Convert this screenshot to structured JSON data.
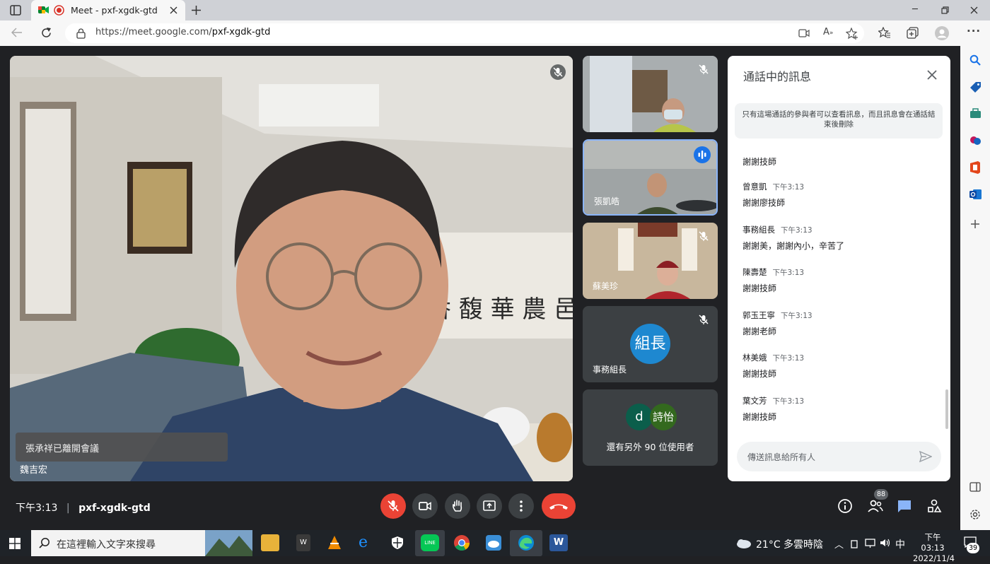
{
  "browser": {
    "tab_title": "Meet - pxf-xgdk-gtd",
    "url_host": "https://meet.google.com/",
    "url_path": "pxf-xgdk-gtd"
  },
  "main_video": {
    "speaker_name": "魏吉宏",
    "toast": "張承祥已離開會議"
  },
  "tiles": [
    {
      "name": ""
    },
    {
      "name": "張凱皓"
    },
    {
      "name": "蘇美珍"
    },
    {
      "name": "事務組長",
      "avatar_text": "組長"
    },
    {
      "avatars": [
        "d",
        "詩怡"
      ],
      "more_label": "還有另外 90 位使用者"
    }
  ],
  "chat": {
    "title": "通話中的訊息",
    "notice": "只有這場通話的參與者可以查看訊息，而且訊息會在通話結束後刪除",
    "messages": [
      {
        "sender": "",
        "time": "",
        "text": "謝謝技師"
      },
      {
        "sender": "曾意凱",
        "time": "下午3:13",
        "text": "謝謝廖技師"
      },
      {
        "sender": "事務組長",
        "time": "下午3:13",
        "text": "謝謝美，謝謝內小，辛苦了"
      },
      {
        "sender": "陳壽楚",
        "time": "下午3:13",
        "text": "謝謝技師"
      },
      {
        "sender": "郭玉王寧",
        "time": "下午3:13",
        "text": "謝謝老師"
      },
      {
        "sender": "林美娥",
        "time": "下午3:13",
        "text": "謝謝技師"
      },
      {
        "sender": "葉文芳",
        "time": "下午3:13",
        "text": "謝謝技師"
      }
    ],
    "input_placeholder": "傳送訊息給所有人"
  },
  "bottom_bar": {
    "time": "下午3:13",
    "meeting_code": "pxf-xgdk-gtd",
    "participants_count": "88"
  },
  "taskbar": {
    "search_placeholder": "在這裡輸入文字來搜尋",
    "weather": "21°C  多雲時陰",
    "ime": "中",
    "clock_time": "下午 03:13",
    "clock_date": "2022/11/4",
    "notifications": "39"
  },
  "colors": {
    "meet_bg": "#202124",
    "end_call": "#ea4335",
    "mic_off": "#ea4335",
    "speaking_border": "#8ab4f8",
    "chat_icon": "#8ab4f8"
  }
}
